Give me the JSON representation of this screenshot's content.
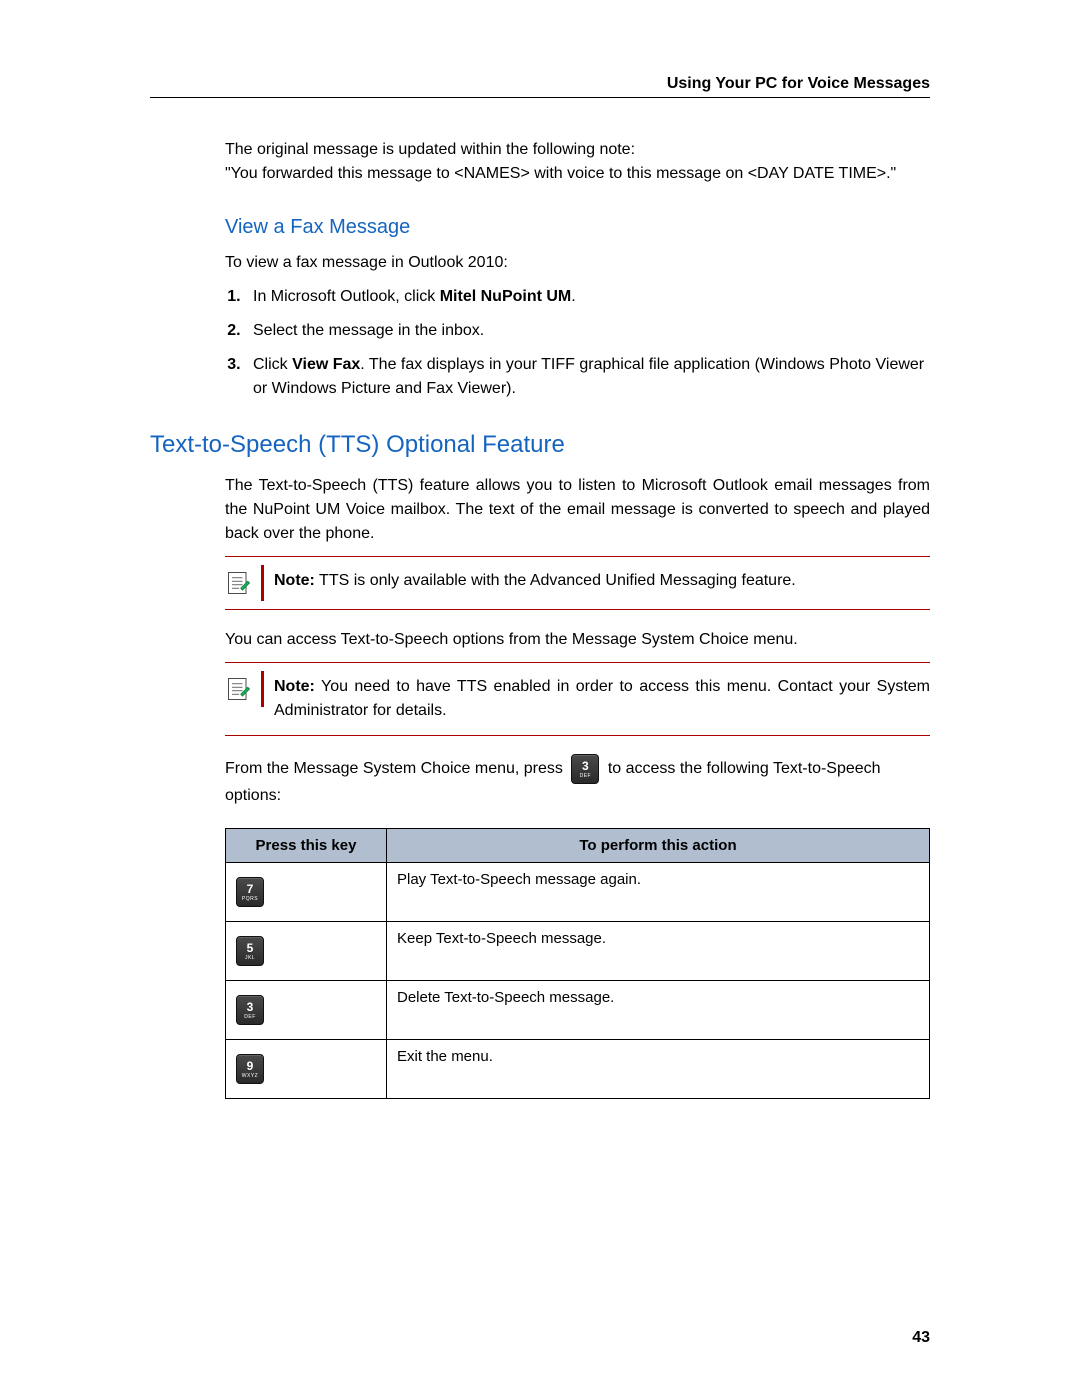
{
  "header": {
    "title": "Using Your PC for Voice Messages"
  },
  "intro": {
    "line1": "The original message is updated within the following note:",
    "line2": "\"You forwarded this message to <NAMES> with voice to this message on <DAY DATE TIME>.\""
  },
  "section_fax": {
    "title": "View a Fax Message",
    "lead": "To view a fax message in Outlook 2010:",
    "steps": [
      {
        "pre": "In Microsoft Outlook, click ",
        "bold": "Mitel NuPoint UM",
        "post": "."
      },
      {
        "pre": "Select the message in the inbox.",
        "bold": "",
        "post": ""
      },
      {
        "pre": "Click ",
        "bold": "View Fax",
        "post": ". The fax displays in your TIFF graphical file application (Windows Photo Viewer or Windows Picture and Fax Viewer)."
      }
    ]
  },
  "section_tts": {
    "title": "Text-to-Speech (TTS) Optional Feature",
    "p1": "The Text-to-Speech (TTS) feature allows you to listen to Microsoft Outlook email messages from the NuPoint UM Voice mailbox. The text of the email message is converted to speech and played back over the phone.",
    "note1": {
      "label": "Note:",
      "text": " TTS is only available with the Advanced Unified Messaging feature."
    },
    "p2": "You can access Text-to-Speech options from the Message System Choice menu.",
    "note2": {
      "label": "Note:",
      "text": " You need to have TTS enabled in order to access this menu. Contact your System Administrator for details."
    },
    "p3_pre": "From the Message System Choice menu, press ",
    "p3_key": {
      "digit": "3",
      "letters": "DEF"
    },
    "p3_post": " to access the following Text-to-Speech options:",
    "table": {
      "head_key": "Press this key",
      "head_action": "To perform this action",
      "rows": [
        {
          "digit": "7",
          "letters": "PQRS",
          "action": "Play Text-to-Speech message again."
        },
        {
          "digit": "5",
          "letters": "JKL",
          "action": "Keep Text-to-Speech message."
        },
        {
          "digit": "3",
          "letters": "DEF",
          "action": "Delete Text-to-Speech message."
        },
        {
          "digit": "9",
          "letters": "WXYZ",
          "action": "Exit the menu."
        }
      ]
    }
  },
  "page_number": "43"
}
